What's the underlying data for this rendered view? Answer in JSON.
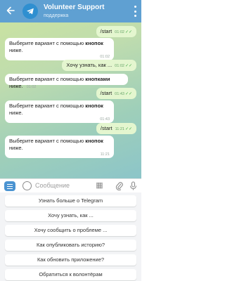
{
  "header": {
    "title": "Volunteer Support",
    "subtitle": "поддержка"
  },
  "messages": [
    {
      "dir": "out",
      "text": "/start",
      "time": "01:02"
    },
    {
      "dir": "in",
      "pre": "Выберите вариант с помощью ",
      "bold": "кнопок",
      "post": " ниже.",
      "time": "01:02"
    },
    {
      "dir": "out",
      "text": "Хочу узнать, как ...",
      "time": "01:02"
    },
    {
      "dir": "in",
      "pre": "Выберите вариант с помощью ",
      "bold": "кнопками",
      "post": " ниже.",
      "time": "01:02"
    },
    {
      "dir": "out",
      "text": "/start",
      "time": "01:43"
    },
    {
      "dir": "in",
      "pre": "Выберите вариант с помощью ",
      "bold": "кнопок",
      "post": " ниже.",
      "time": "01:43"
    },
    {
      "dir": "out",
      "text": "/start",
      "time": "11:21"
    },
    {
      "dir": "in",
      "pre": "Выберите вариант с помощью ",
      "bold": "кнопок",
      "post": " ниже.",
      "time": "11:21"
    }
  ],
  "composer": {
    "placeholder": "Сообщение"
  },
  "keyboard": {
    "buttons": [
      "Узнать больше о Telegram",
      "Хочу узнать, как ...",
      "Хочу сообщить о проблеме ...",
      "Как опубликовать историю?",
      "Как обновить приложение?",
      "Обратиться к волонтёрам"
    ]
  },
  "colors": {
    "header": "#5fa0d2",
    "outgoing_bubble": "#e4f6cf",
    "incoming_bubble": "#ffffff",
    "accent": "#4a93d1"
  }
}
